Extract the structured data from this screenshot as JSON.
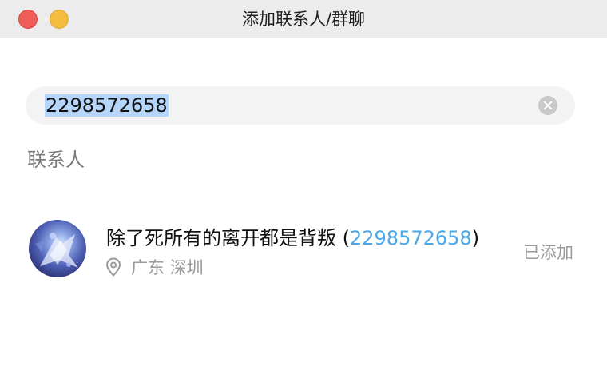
{
  "window": {
    "title": "添加联系人/群聊"
  },
  "search": {
    "value": "2298572658"
  },
  "section": {
    "label": "联系人"
  },
  "result": {
    "name": "除了死所有的离开都是背叛",
    "id_open": " (",
    "id": "2298572658",
    "id_close": ")",
    "location": "广东 深圳",
    "status": "已添加"
  },
  "colors": {
    "id_highlight": "#4aa8e8",
    "selection": "#b5d5fb",
    "close_button": "#ee5d57",
    "minimize_button": "#f5bd40"
  },
  "icons": {
    "clear": "clear-icon",
    "location": "location-pin-icon"
  }
}
